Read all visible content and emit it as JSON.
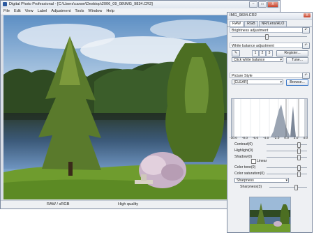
{
  "window": {
    "title": "Digital Photo Professional - [C:\\Users\\canon\\Desktop\\2006_09_08\\IMG_9834.CR2]",
    "minimize": "–",
    "maximize": "□",
    "close": "X"
  },
  "menu": [
    "File",
    "Edit",
    "View",
    "Label",
    "Adjustment",
    "Tools",
    "Window",
    "Help"
  ],
  "status": {
    "color_space": "RAW / sRGB",
    "quality": "High quality"
  },
  "palette": {
    "title": "IMG_9834.CR2",
    "close": "X",
    "tabs": [
      "RAW",
      "RGB",
      "NR/Lens/ALO"
    ],
    "brightness_label": "Brightness adjustment",
    "reset_icon": "↶",
    "wb_label": "White balance adjustment",
    "register": "Register...",
    "tune": "Tune...",
    "wb_select": "Click white balance",
    "wb_nums": [
      "1",
      "2",
      "3"
    ],
    "picture_style_label": "Picture Style",
    "picture_style_value": "[CLEAR]",
    "browse": "Browse...",
    "histogram_ticks": [
      "-10.0",
      "-8.0",
      "-6.0",
      "-4.0",
      "-2.0",
      "0.0",
      "2.0",
      "4.0"
    ],
    "contrast": "Contrast(0)",
    "highlight": "Highlight(0)",
    "shadow": "Shadow(0)",
    "linear": "Linear",
    "color_tone": "Color tone(0)",
    "color_saturation": "Color saturation(0)",
    "sharpness_select": "Sharpness",
    "sharpness_value": "Sharpness(3)"
  },
  "colors": {
    "accent": "#2c5aa0",
    "close": "#c8422b"
  }
}
